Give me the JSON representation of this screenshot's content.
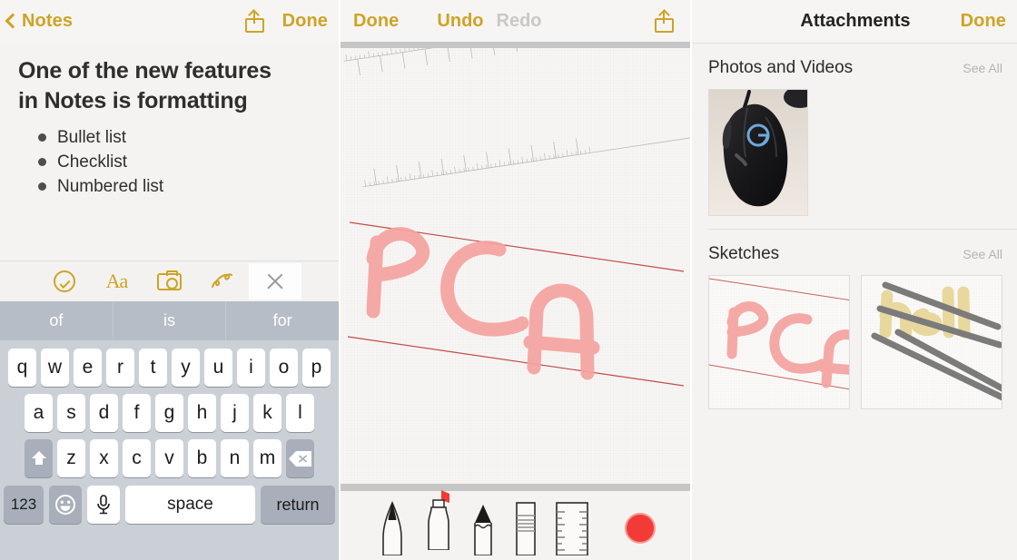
{
  "app": {
    "platform": "ios-notes",
    "accent_gold": "#cfa325",
    "accent_red": "#f23b36",
    "highlighter_pink": "#f5a3a0"
  },
  "left_panel": {
    "nav": {
      "back_label": "Notes",
      "back_icon": "chevron-left-icon",
      "share_icon": "share-icon",
      "done_label": "Done"
    },
    "note": {
      "title_line1": "One of the new features",
      "title_line2": "in Notes is formatting",
      "bullets": [
        {
          "label": "Bullet list"
        },
        {
          "label": "Checklist"
        },
        {
          "label": "Numbered list"
        }
      ]
    },
    "format_toolbar": {
      "items": [
        {
          "name": "checklist-icon",
          "label": ""
        },
        {
          "name": "text-format-icon",
          "label": "Aa"
        },
        {
          "name": "camera-icon",
          "label": ""
        },
        {
          "name": "sketch-icon",
          "label": ""
        },
        {
          "name": "close-icon",
          "label": "",
          "selected": true
        }
      ]
    },
    "predictive": {
      "suggestions": [
        "of",
        "is",
        "for"
      ]
    },
    "keyboard": {
      "row1": [
        "q",
        "w",
        "e",
        "r",
        "t",
        "y",
        "u",
        "i",
        "o",
        "p"
      ],
      "row2": [
        "a",
        "s",
        "d",
        "f",
        "g",
        "h",
        "j",
        "k",
        "l"
      ],
      "row3_letters": [
        "z",
        "x",
        "c",
        "v",
        "b",
        "n",
        "m"
      ],
      "shift_label": "",
      "delete_label": "",
      "numbers_label": "123",
      "emoji_label": "",
      "mic_label": "",
      "space_label": "space",
      "return_label": "return"
    }
  },
  "middle_panel": {
    "nav": {
      "done_label": "Done",
      "undo_label": "Undo",
      "redo_label": "Redo",
      "redo_disabled": true,
      "share_icon": "share-icon"
    },
    "canvas": {
      "sketch_text": "PCA",
      "ruler_visible": true,
      "ruled_lines": 2,
      "ink_color": "#f5a3a0",
      "line_color": "#c44b47"
    },
    "draw_tools": {
      "items": [
        {
          "name": "pen-tool",
          "selected": false
        },
        {
          "name": "highlighter-tool",
          "selected": true
        },
        {
          "name": "pencil-tool",
          "selected": false
        },
        {
          "name": "eraser-tool",
          "selected": false
        },
        {
          "name": "ruler-tool",
          "selected": false
        }
      ],
      "color_swatch": "#f23b36"
    }
  },
  "right_panel": {
    "nav": {
      "title": "Attachments",
      "done_label": "Done"
    },
    "sections": [
      {
        "title": "Photos and Videos",
        "see_all_label": "See All",
        "items": [
          {
            "name": "photo-thumbnail-mouse",
            "caption": ""
          }
        ]
      },
      {
        "title": "Sketches",
        "see_all_label": "See All",
        "items": [
          {
            "name": "sketch-thumbnail-pca",
            "caption": "PCA"
          },
          {
            "name": "sketch-thumbnail-hell",
            "caption": "hell"
          }
        ]
      }
    ]
  }
}
